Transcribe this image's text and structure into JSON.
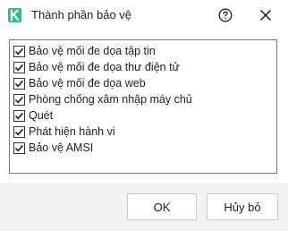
{
  "window": {
    "title": "Thành phần bảo vệ",
    "logo_icon": "kaspersky-k-icon",
    "help_icon": "question-circle-icon",
    "close_icon": "close-x-icon",
    "accent_color": "#29c18a"
  },
  "components": [
    {
      "label": "Bảo vệ mối đe dọa tập tin",
      "checked": true
    },
    {
      "label": "Bảo vệ mối đe dọa thư điện tử",
      "checked": true
    },
    {
      "label": "Bảo vệ mối đe dọa web",
      "checked": true
    },
    {
      "label": "Phòng chống xâm nhập máy chủ",
      "checked": true
    },
    {
      "label": "Quét",
      "checked": true
    },
    {
      "label": "Phát hiện hành vi",
      "checked": true
    },
    {
      "label": "Bảo vệ AMSI",
      "checked": true
    }
  ],
  "footer": {
    "ok_label": "OK",
    "cancel_label": "Hủy bỏ"
  }
}
